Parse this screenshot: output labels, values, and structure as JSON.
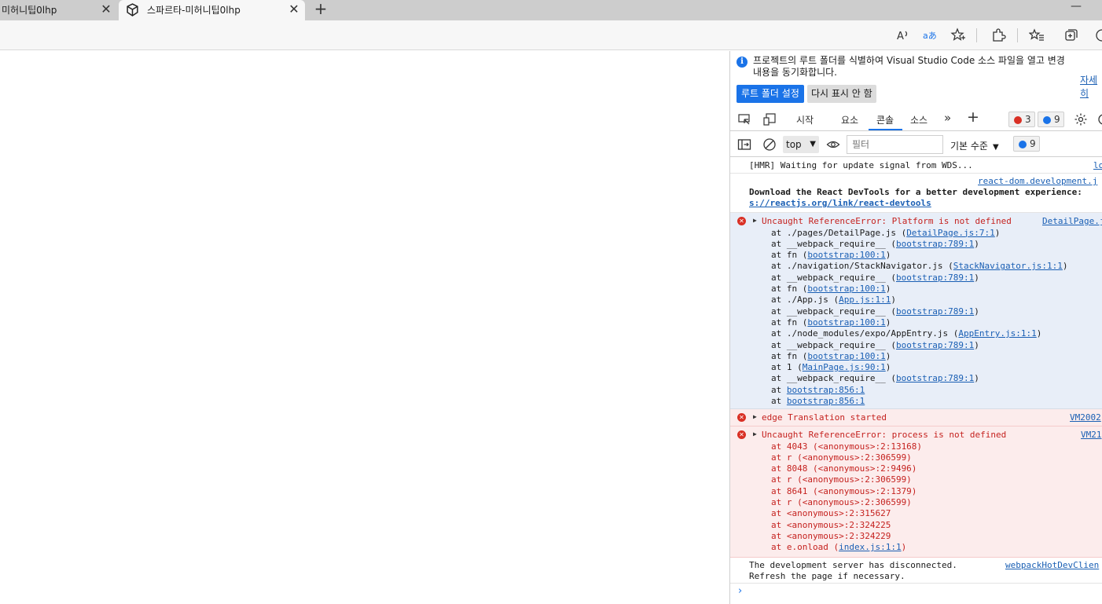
{
  "tabs": [
    {
      "title": "미허니팁0lhp"
    },
    {
      "title": "스파르타-미허니팁0lhp"
    }
  ],
  "devtools": {
    "info": {
      "message": "프로젝트의 루트 폴더를 식별하여 Visual Studio Code 소스 파일을 열고 변경 내용을 동기화합니다.",
      "learn_more": "자세히",
      "primary": "루트 폴더 설정",
      "secondary": "다시 표시 안 함"
    },
    "tabs": [
      "시작",
      "요소",
      "콘솔",
      "소스"
    ],
    "error_count": "3",
    "message_count": "9",
    "context": "top",
    "filter_placeholder": "필터",
    "levels": "기본 수준",
    "filter_message_count": "9"
  },
  "console": {
    "hmr": "[HMR] Waiting for update signal from WDS...",
    "hmr_src": "lo",
    "react_src": "react-dom.development.j",
    "react_msg": "Download the React DevTools for a better development experience:",
    "react_link": "s://reactjs.org/link/react-devtools",
    "error1": {
      "title": "Uncaught ReferenceError: Platform is not defined",
      "src": "DetailPage.j",
      "stack": [
        {
          "text": "at ./pages/DetailPage.js (",
          "link": "DetailPage.js:7:1",
          "tail": ")"
        },
        {
          "text": "at __webpack_require__ (",
          "link": "bootstrap:789:1",
          "tail": ")"
        },
        {
          "text": "at fn (",
          "link": "bootstrap:100:1",
          "tail": ")"
        },
        {
          "text": "at ./navigation/StackNavigator.js (",
          "link": "StackNavigator.js:1:1",
          "tail": ")"
        },
        {
          "text": "at __webpack_require__ (",
          "link": "bootstrap:789:1",
          "tail": ")"
        },
        {
          "text": "at fn (",
          "link": "bootstrap:100:1",
          "tail": ")"
        },
        {
          "text": "at ./App.js (",
          "link": "App.js:1:1",
          "tail": ")"
        },
        {
          "text": "at __webpack_require__ (",
          "link": "bootstrap:789:1",
          "tail": ")"
        },
        {
          "text": "at fn (",
          "link": "bootstrap:100:1",
          "tail": ")"
        },
        {
          "text": "at ./node_modules/expo/AppEntry.js (",
          "link": "AppEntry.js:1:1",
          "tail": ")"
        },
        {
          "text": "at __webpack_require__ (",
          "link": "bootstrap:789:1",
          "tail": ")"
        },
        {
          "text": "at fn (",
          "link": "bootstrap:100:1",
          "tail": ")"
        },
        {
          "text": "at 1 (",
          "link": "MainPage.js:90:1",
          "tail": ")"
        },
        {
          "text": "at __webpack_require__ (",
          "link": "bootstrap:789:1",
          "tail": ")"
        },
        {
          "text": "at ",
          "link": "bootstrap:856:1",
          "tail": ""
        },
        {
          "text": "at ",
          "link": "bootstrap:856:1",
          "tail": ""
        }
      ]
    },
    "error2": {
      "title": "edge Translation started",
      "src": "VM2002"
    },
    "error3": {
      "title": "Uncaught ReferenceError: process is not defined",
      "src": "VM21",
      "stack": [
        {
          "text": "at 4043 (<anonymous>:2:13168)",
          "link": "",
          "tail": ""
        },
        {
          "text": "at r (<anonymous>:2:306599)",
          "link": "",
          "tail": ""
        },
        {
          "text": "at 8048 (<anonymous>:2:9496)",
          "link": "",
          "tail": ""
        },
        {
          "text": "at r (<anonymous>:2:306599)",
          "link": "",
          "tail": ""
        },
        {
          "text": "at 8641 (<anonymous>:2:1379)",
          "link": "",
          "tail": ""
        },
        {
          "text": "at r (<anonymous>:2:306599)",
          "link": "",
          "tail": ""
        },
        {
          "text": "at <anonymous>:2:315627",
          "link": "",
          "tail": ""
        },
        {
          "text": "at <anonymous>:2:324225",
          "link": "",
          "tail": ""
        },
        {
          "text": "at <anonymous>:2:324229",
          "link": "",
          "tail": ""
        },
        {
          "text": "at e.onload (",
          "link": "index.js:1:1",
          "tail": ")"
        }
      ]
    },
    "disconnect": {
      "line1": "The development server has disconnected.",
      "line2": "Refresh the page if necessary.",
      "src": "webpackHotDevClien"
    }
  }
}
